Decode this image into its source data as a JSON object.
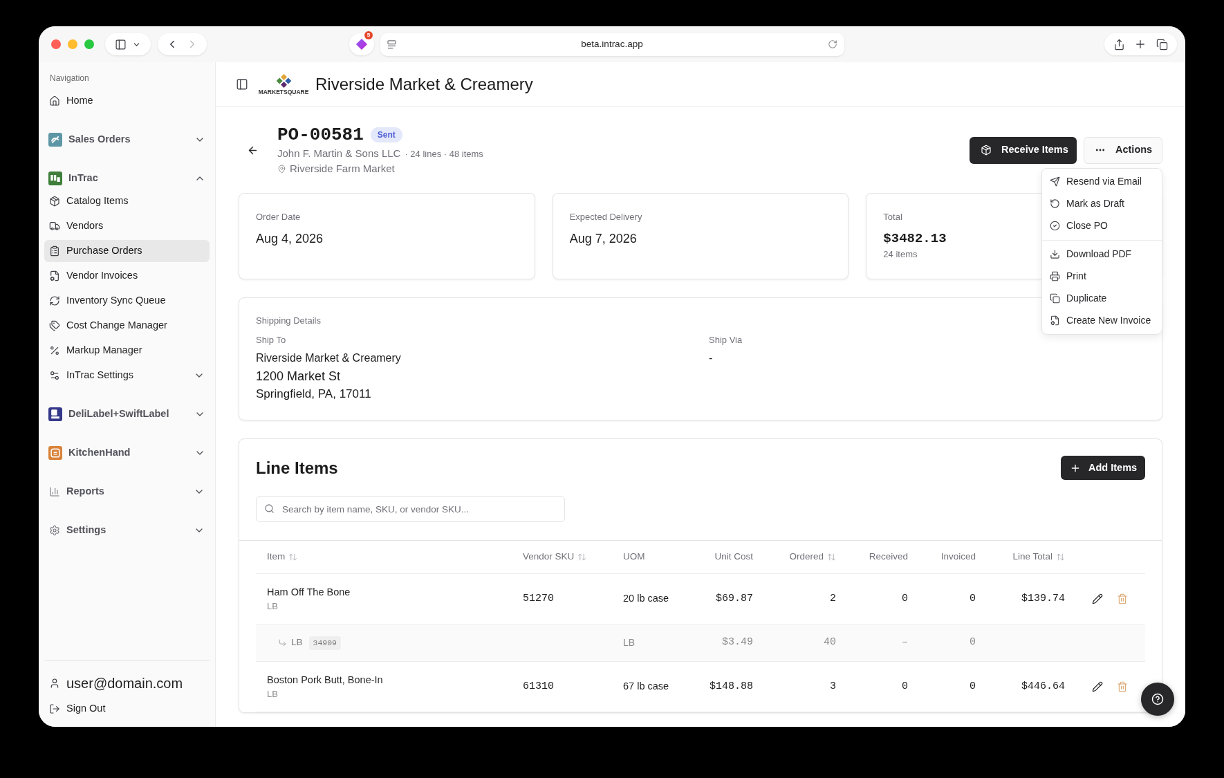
{
  "browser": {
    "url": "beta.intrac.app",
    "extension_badge": "5"
  },
  "sidebar": {
    "heading": "Navigation",
    "items": [
      {
        "kind": "link",
        "label": "Home",
        "selected": false
      },
      {
        "kind": "app",
        "label": "Sales Orders",
        "color": "#5d96a5",
        "expanded": false
      },
      {
        "kind": "app",
        "label": "InTrac",
        "color": "#3f7d3a",
        "expanded": true,
        "children": [
          {
            "kind": "link",
            "label": "Catalog Items",
            "selected": false
          },
          {
            "kind": "link",
            "label": "Vendors",
            "selected": false
          },
          {
            "kind": "link",
            "label": "Purchase Orders",
            "selected": true
          },
          {
            "kind": "link",
            "label": "Vendor Invoices",
            "selected": false
          },
          {
            "kind": "link",
            "label": "Inventory Sync Queue",
            "selected": false
          },
          {
            "kind": "link",
            "label": "Cost Change Manager",
            "selected": false
          },
          {
            "kind": "link",
            "label": "Markup Manager",
            "selected": false
          },
          {
            "kind": "submenu",
            "label": "InTrac Settings",
            "expanded": false
          }
        ]
      },
      {
        "kind": "app",
        "label": "DeliLabel+SwiftLabel",
        "color": "#34388a",
        "expanded": false
      },
      {
        "kind": "app",
        "label": "KitchenHand",
        "color": "#d9833a",
        "expanded": false
      },
      {
        "kind": "section",
        "label": "Reports",
        "expanded": false
      },
      {
        "kind": "section",
        "label": "Settings",
        "expanded": false
      }
    ]
  },
  "account": {
    "email": "user@domain.com",
    "sign_out": "Sign Out"
  },
  "header": {
    "logo_text": "MARKETSQUARE",
    "store_name": "Riverside Market & Creamery"
  },
  "order": {
    "number": "PO-00581",
    "status": "Sent",
    "vendor": "John F. Martin & Sons LLC",
    "summary": "· 24 lines · 48 items",
    "location": "Riverside Farm Market"
  },
  "buttons": {
    "receive": "Receive Items",
    "actions": {
      "label": "Actions",
      "expanded": true,
      "menu": [
        {
          "items": [
            {
              "label": "Resend via Email"
            },
            {
              "label": "Mark as Draft"
            },
            {
              "label": "Close PO"
            }
          ]
        },
        {
          "items": [
            {
              "label": "Download PDF"
            },
            {
              "label": "Print"
            },
            {
              "label": "Duplicate"
            },
            {
              "label": "Create New Invoice"
            }
          ]
        }
      ]
    }
  },
  "stats": [
    {
      "kind": "date",
      "label": "Order Date",
      "value": "Aug 4, 2026"
    },
    {
      "kind": "date",
      "label": "Expected Delivery",
      "value": "Aug 7, 2026"
    },
    {
      "kind": "amount",
      "label": "Total",
      "value": "$3482.13",
      "note": "24 items"
    }
  ],
  "shipping": {
    "title": "Shipping Details",
    "ship_to": {
      "label": "Ship To",
      "lines": [
        "Riverside Market & Creamery",
        "1200 Market St",
        "Springfield, PA, 17011"
      ]
    },
    "ship_via": {
      "label": "Ship Via",
      "value": "-"
    }
  },
  "line_items": {
    "title": "Line Items",
    "add_button": "Add Items",
    "search": {
      "placeholder": "Search by item name, SKU, or vendor SKU..."
    },
    "columns": [
      {
        "label": "Item",
        "sortable": true
      },
      {
        "label": "Vendor SKU",
        "sortable": true
      },
      {
        "label": "UOM",
        "sortable": false
      },
      {
        "label": "Unit Cost",
        "sortable": false
      },
      {
        "label": "Ordered",
        "sortable": true
      },
      {
        "label": "Received",
        "sortable": false
      },
      {
        "label": "Invoiced",
        "sortable": false
      },
      {
        "label": "Line Total",
        "sortable": true
      }
    ],
    "rows": [
      {
        "kind": "item",
        "name": "Ham Off The Bone",
        "unit": "LB",
        "vendor_sku": "51270",
        "uom": "20 lb case",
        "unit_cost": "$69.87",
        "ordered": "2",
        "received": "0",
        "invoiced": "0",
        "line_total": "$139.74"
      },
      {
        "kind": "breakdown",
        "pack_unit": "LB",
        "sku": "34909",
        "uom": "LB",
        "unit_cost": "$3.49",
        "ordered": "40",
        "received": "–",
        "invoiced": "0"
      },
      {
        "kind": "item",
        "name": "Boston Pork Butt, Bone-In",
        "unit": "LB",
        "vendor_sku": "61310",
        "uom": "67 lb case",
        "unit_cost": "$148.88",
        "ordered": "3",
        "received": "0",
        "invoiced": "0",
        "line_total": "$446.64"
      }
    ]
  }
}
